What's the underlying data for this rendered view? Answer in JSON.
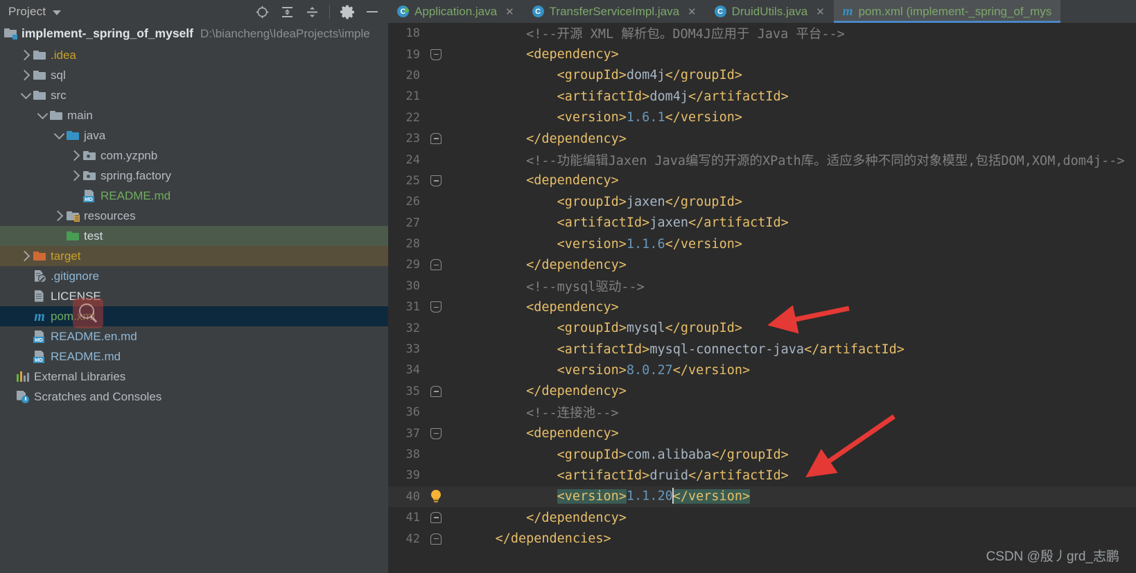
{
  "panel": {
    "title": "Project",
    "icons": [
      "locate-target-icon",
      "expand-all-icon",
      "collapse-all-icon",
      "settings-gear-icon",
      "minimize-icon"
    ],
    "project_name": "implement-_spring_of_myself",
    "project_path": "D:\\biancheng\\IdeaProjects\\imple",
    "tree": [
      {
        "label": ".idea",
        "indent": 1,
        "arrow": "right",
        "icon": "folder-grey-icon",
        "color": "#c9a227",
        "state": "normal"
      },
      {
        "label": "sql",
        "indent": 1,
        "arrow": "right",
        "icon": "folder-grey-icon",
        "color": "#b5bcc4",
        "state": "normal"
      },
      {
        "label": "src",
        "indent": 1,
        "arrow": "down",
        "icon": "folder-grey-icon",
        "color": "#b5bcc4",
        "state": "normal"
      },
      {
        "label": "main",
        "indent": 2,
        "arrow": "down",
        "icon": "folder-grey-icon",
        "color": "#b5bcc4",
        "state": "normal"
      },
      {
        "label": "java",
        "indent": 3,
        "arrow": "down",
        "icon": "folder-blue-icon",
        "color": "#b5bcc4",
        "state": "normal"
      },
      {
        "label": "com.yzpnb",
        "indent": 4,
        "arrow": "right",
        "icon": "package-icon",
        "color": "#b5bcc4",
        "state": "normal"
      },
      {
        "label": "spring.factory",
        "indent": 4,
        "arrow": "right",
        "icon": "package-icon",
        "color": "#b5bcc4",
        "state": "normal"
      },
      {
        "label": "README.md",
        "indent": 4,
        "arrow": "none",
        "icon": "markdown-icon",
        "color": "#6fae61",
        "state": "normal"
      },
      {
        "label": "resources",
        "indent": 3,
        "arrow": "right",
        "icon": "resources-folder-icon",
        "color": "#b5bcc4",
        "state": "normal"
      },
      {
        "label": "test",
        "indent": 3,
        "arrow": "none",
        "icon": "folder-green-icon",
        "color": "#d5dbe0",
        "state": "test"
      },
      {
        "label": "target",
        "indent": 1,
        "arrow": "right",
        "icon": "folder-orange-icon",
        "color": "#c9a227",
        "state": "target"
      },
      {
        "label": ".gitignore",
        "indent": 1,
        "arrow": "none",
        "icon": "gitignore-icon",
        "color": "#8fb8d8",
        "state": "normal"
      },
      {
        "label": "LICENSE",
        "indent": 1,
        "arrow": "none",
        "icon": "document-icon",
        "color": "#d5dbe0",
        "state": "normal"
      },
      {
        "label": "pom.xml",
        "indent": 1,
        "arrow": "none",
        "icon": "maven-m-icon",
        "color": "#6fae61",
        "state": "selected"
      },
      {
        "label": "README.en.md",
        "indent": 1,
        "arrow": "none",
        "icon": "markdown-icon",
        "color": "#8fb8d8",
        "state": "normal"
      },
      {
        "label": "README.md",
        "indent": 1,
        "arrow": "none",
        "icon": "markdown-icon",
        "color": "#8fb8d8",
        "state": "normal"
      },
      {
        "label": "External Libraries",
        "indent": 0,
        "arrow": "none",
        "icon": "libraries-icon",
        "color": "#b5bcc4",
        "state": "normal"
      },
      {
        "label": "Scratches and Consoles",
        "indent": 0,
        "arrow": "none",
        "icon": "scratches-icon",
        "color": "#b5bcc4",
        "state": "normal"
      }
    ]
  },
  "editor": {
    "tabs": [
      {
        "label": "Application.java",
        "icon": "java-class-run-icon",
        "active": false,
        "closable": true
      },
      {
        "label": "TransferServiceImpl.java",
        "icon": "java-class-icon",
        "active": false,
        "closable": true
      },
      {
        "label": "DruidUtils.java",
        "icon": "java-class-icon",
        "active": false,
        "closable": true
      },
      {
        "label": "pom.xml (implement-_spring_of_mys",
        "icon": "maven-m-icon",
        "active": true,
        "closable": false
      }
    ],
    "first_line_number": 18,
    "lines": [
      {
        "n": 18,
        "fold": "none",
        "indent": 2,
        "parts": [
          {
            "t": "comment",
            "s": "<!--开源 XML 解析包。DOM4J应用于 Java 平台-->"
          }
        ]
      },
      {
        "n": 19,
        "fold": "start",
        "indent": 2,
        "parts": [
          {
            "t": "tag",
            "s": "<dependency>"
          }
        ]
      },
      {
        "n": 20,
        "fold": "none",
        "indent": 3,
        "parts": [
          {
            "t": "tag",
            "s": "<groupId>"
          },
          {
            "t": "val",
            "s": "dom4j"
          },
          {
            "t": "tag",
            "s": "</groupId>"
          }
        ]
      },
      {
        "n": 21,
        "fold": "none",
        "indent": 3,
        "parts": [
          {
            "t": "tag",
            "s": "<artifactId>"
          },
          {
            "t": "val",
            "s": "dom4j"
          },
          {
            "t": "tag",
            "s": "</artifactId>"
          }
        ]
      },
      {
        "n": 22,
        "fold": "none",
        "indent": 3,
        "parts": [
          {
            "t": "tag",
            "s": "<version>"
          },
          {
            "t": "num",
            "s": "1.6.1"
          },
          {
            "t": "tag",
            "s": "</version>"
          }
        ]
      },
      {
        "n": 23,
        "fold": "end",
        "indent": 2,
        "parts": [
          {
            "t": "tag",
            "s": "</dependency>"
          }
        ]
      },
      {
        "n": 24,
        "fold": "none",
        "indent": 2,
        "parts": [
          {
            "t": "comment",
            "s": "<!--功能编辑Jaxen Java编写的开源的XPath库。适应多种不同的对象模型,包括DOM,XOM,dom4j-->"
          }
        ]
      },
      {
        "n": 25,
        "fold": "start",
        "indent": 2,
        "parts": [
          {
            "t": "tag",
            "s": "<dependency>"
          }
        ]
      },
      {
        "n": 26,
        "fold": "none",
        "indent": 3,
        "parts": [
          {
            "t": "tag",
            "s": "<groupId>"
          },
          {
            "t": "val",
            "s": "jaxen"
          },
          {
            "t": "tag",
            "s": "</groupId>"
          }
        ]
      },
      {
        "n": 27,
        "fold": "none",
        "indent": 3,
        "parts": [
          {
            "t": "tag",
            "s": "<artifactId>"
          },
          {
            "t": "val",
            "s": "jaxen"
          },
          {
            "t": "tag",
            "s": "</artifactId>"
          }
        ]
      },
      {
        "n": 28,
        "fold": "none",
        "indent": 3,
        "parts": [
          {
            "t": "tag",
            "s": "<version>"
          },
          {
            "t": "num",
            "s": "1.1.6"
          },
          {
            "t": "tag",
            "s": "</version>"
          }
        ]
      },
      {
        "n": 29,
        "fold": "end",
        "indent": 2,
        "parts": [
          {
            "t": "tag",
            "s": "</dependency>"
          }
        ]
      },
      {
        "n": 30,
        "fold": "none",
        "indent": 2,
        "parts": [
          {
            "t": "comment",
            "s": "<!--mysql驱动-->"
          }
        ]
      },
      {
        "n": 31,
        "fold": "start",
        "indent": 2,
        "parts": [
          {
            "t": "tag",
            "s": "<dependency>"
          }
        ]
      },
      {
        "n": 32,
        "fold": "none",
        "indent": 3,
        "parts": [
          {
            "t": "tag",
            "s": "<groupId>"
          },
          {
            "t": "val",
            "s": "mysql"
          },
          {
            "t": "tag",
            "s": "</groupId>"
          }
        ]
      },
      {
        "n": 33,
        "fold": "none",
        "indent": 3,
        "parts": [
          {
            "t": "tag",
            "s": "<artifactId>"
          },
          {
            "t": "val",
            "s": "mysql-connector-java"
          },
          {
            "t": "tag",
            "s": "</artifactId>"
          }
        ]
      },
      {
        "n": 34,
        "fold": "none",
        "indent": 3,
        "parts": [
          {
            "t": "tag",
            "s": "<version>"
          },
          {
            "t": "num",
            "s": "8.0.27"
          },
          {
            "t": "tag",
            "s": "</version>"
          }
        ]
      },
      {
        "n": 35,
        "fold": "end",
        "indent": 2,
        "parts": [
          {
            "t": "tag",
            "s": "</dependency>"
          }
        ]
      },
      {
        "n": 36,
        "fold": "none",
        "indent": 2,
        "parts": [
          {
            "t": "comment",
            "s": "<!--连接池-->"
          }
        ]
      },
      {
        "n": 37,
        "fold": "start",
        "indent": 2,
        "parts": [
          {
            "t": "tag",
            "s": "<dependency>"
          }
        ]
      },
      {
        "n": 38,
        "fold": "none",
        "indent": 3,
        "parts": [
          {
            "t": "tag",
            "s": "<groupId>"
          },
          {
            "t": "val",
            "s": "com.alibaba"
          },
          {
            "t": "tag",
            "s": "</groupId>"
          }
        ]
      },
      {
        "n": 39,
        "fold": "none",
        "indent": 3,
        "parts": [
          {
            "t": "tag",
            "s": "<artifactId>"
          },
          {
            "t": "val",
            "s": "druid"
          },
          {
            "t": "tag",
            "s": "</artifactId>"
          }
        ]
      },
      {
        "n": 40,
        "fold": "bulb",
        "indent": 3,
        "current": true,
        "parts": [
          {
            "t": "sel-tag",
            "s": "<version>"
          },
          {
            "t": "num",
            "s": "1.1.20"
          },
          {
            "t": "caret",
            "s": ""
          },
          {
            "t": "sel-tag",
            "s": "</version>"
          }
        ]
      },
      {
        "n": 41,
        "fold": "end",
        "indent": 2,
        "parts": [
          {
            "t": "tag",
            "s": "</dependency>"
          }
        ]
      },
      {
        "n": 42,
        "fold": "end",
        "indent": 1,
        "parts": [
          {
            "t": "tag",
            "s": "</dependencies>"
          }
        ]
      }
    ],
    "annotations": [
      {
        "name": "arrow-pointing-to-mysql-groupid",
        "color": "#e53935"
      },
      {
        "name": "arrow-pointing-to-druid-version",
        "color": "#e53935"
      }
    ]
  },
  "watermark": "CSDN @殷丿grd_志鹏",
  "colors": {
    "panel_bg": "#3c3f41",
    "editor_bg": "#2b2b2b",
    "tab_active_bg": "#4e5254",
    "tab_underline": "#4a88c7",
    "selection_bg": "#0d293e",
    "tag": "#e8bf6a",
    "value": "#a9b7c6",
    "number": "#6897bb",
    "comment": "#808080",
    "selected_tag_bg": "#3a5c52",
    "test_row_bg": "#4c5a4c",
    "target_row_bg": "#584f3b",
    "arrow_red": "#e53935"
  }
}
